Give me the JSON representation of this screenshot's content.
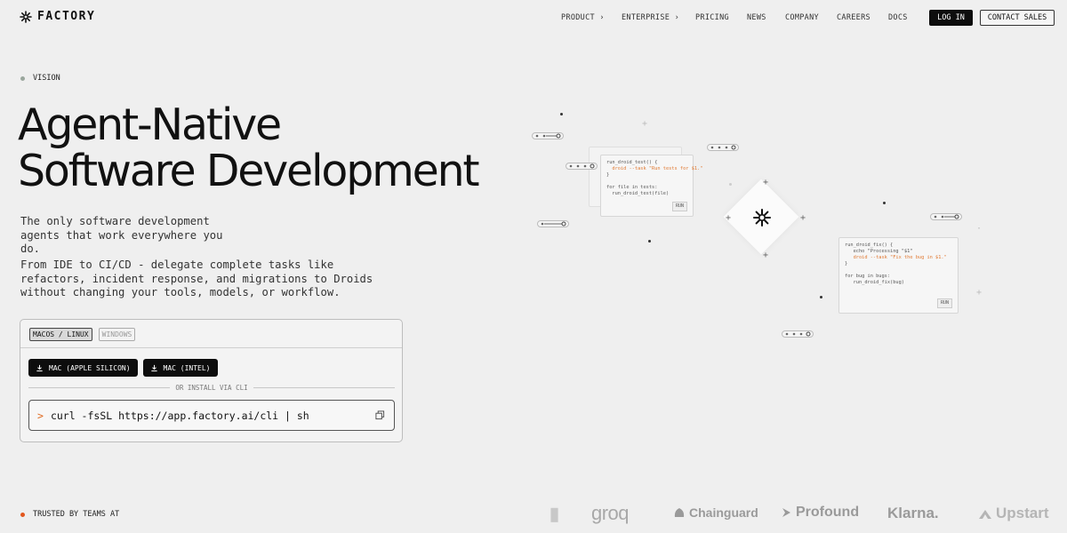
{
  "brand": {
    "name": "FACTORY"
  },
  "nav": {
    "items": [
      {
        "label": "PRODUCT",
        "has_chevron": true
      },
      {
        "label": "ENTERPRISE",
        "has_chevron": true
      },
      {
        "label": "PRICING"
      },
      {
        "label": "NEWS"
      },
      {
        "label": "COMPANY"
      },
      {
        "label": "CAREERS"
      },
      {
        "label": "DOCS"
      }
    ],
    "chevron": "›",
    "login": "LOG IN",
    "contact": "CONTACT SALES"
  },
  "hero": {
    "eyebrow": "VISION",
    "headline_line1": "Agent-Native",
    "headline_line2": "Software Development",
    "sub1": "The only software development agents that work everywhere you do.",
    "sub2": "From IDE to CI/CD - delegate complete tasks like refactors, incident response, and migrations to Droids without changing your tools, models, or workflow."
  },
  "install": {
    "tabs": [
      {
        "label": "MACOS / LINUX",
        "active": true
      },
      {
        "label": "WINDOWS",
        "active": false
      }
    ],
    "buttons": [
      {
        "label": "MAC (APPLE SILICON)",
        "icon": "download-icon"
      },
      {
        "label": "MAC (INTEL)",
        "icon": "download-icon"
      }
    ],
    "divider_label": "OR INSTALL VIA CLI",
    "prompt": ">",
    "command": "curl -fsSL https://app.factory.ai/cli | sh",
    "copy_icon": "copy-icon"
  },
  "illustration": {
    "card1": {
      "lines": [
        "run_droid_test() {",
        "  droid --task \"Run tests for $1.\"",
        "}",
        "",
        "for file in tests:",
        "  run_droid_test(file)"
      ],
      "run": "RUN"
    },
    "card2": {
      "lines": [
        "run_droid_fix() {",
        "   echo \"Processing \"$1\"",
        "   droid --task \"Fix the bug in $1.\"",
        "}",
        "",
        "for bug in bugs:",
        "   run_droid_fix(bug)"
      ],
      "run": "RUN"
    }
  },
  "footer": {
    "trusted_label": "TRUSTED BY TEAMS AT",
    "logos": [
      "groq",
      "Chainguard",
      "Profound",
      "Klarna.",
      "Upstart"
    ]
  },
  "colors": {
    "background": "#efefef",
    "accent_orange": "#e2571e",
    "dot_gray": "#9aa79d",
    "dark": "#0d0d0d"
  }
}
